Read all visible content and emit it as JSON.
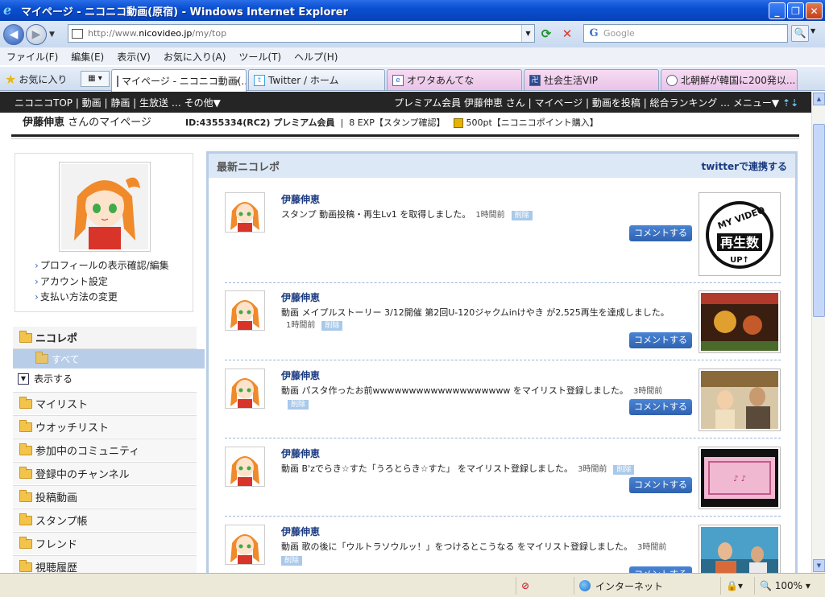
{
  "window": {
    "title": "マイページ - ニコニコ動画(原宿) - Windows Internet Explorer"
  },
  "address": {
    "url_prefix": "http://www.",
    "url_domain": "nicovideo.jp",
    "url_path": "/my/top"
  },
  "search": {
    "placeholder": "Google"
  },
  "menu": [
    "ファイル(F)",
    "編集(E)",
    "表示(V)",
    "お気に入り(A)",
    "ツール(T)",
    "ヘルプ(H)"
  ],
  "favorites_label": "お気に入り",
  "tabs": [
    {
      "label": "マイページ - ニコニコ動画(...",
      "icon": "page-icon"
    },
    {
      "label": "Twitter / ホーム",
      "icon": "twitter-icon"
    },
    {
      "label": "オワタあんてな",
      "icon": "ie-icon"
    },
    {
      "label": "社会生活VIP",
      "icon": "site-icon"
    },
    {
      "label": "北朝鮮が韓国に200発以...",
      "icon": "loading-icon"
    }
  ],
  "nicobar": {
    "left": "ニコニコTOP | 動画 | 静画 | 生放送 … その他▼",
    "right": "プレミアム会員 伊藤伸恵 さん | マイページ | 動画を投稿 | 総合ランキング … メニュー▼"
  },
  "user": {
    "name": "伊藤伸恵",
    "mypage_suffix": " さんのマイページ",
    "id_info": "ID:4355334(RC2) プレミアム会員",
    "exp": "8  EXP【スタンプ確認】",
    "points": "500pt【ニコニコポイント購入】"
  },
  "profile_links": [
    "プロフィールの表示確認/編集",
    "アカウント設定",
    "支払い方法の変更"
  ],
  "sidebar": {
    "nicorepo": "ニコレポ",
    "all": "すべて",
    "toggle": "表示する",
    "items": [
      "マイリスト",
      "ウオッチリスト",
      "参加中のコミュニティ",
      "登録中のチャンネル",
      "投稿動画",
      "スタンプ帳",
      "フレンド",
      "視聴履歴"
    ]
  },
  "main": {
    "title": "最新ニコレポ",
    "twitter_link": "twitterで連携する",
    "comment_label": "コメントする",
    "delete_label": "削除",
    "entries": [
      {
        "name": "伊藤伸恵",
        "text": "スタンプ 動画投稿・再生Lv1 を取得しました。",
        "time": "1時間前",
        "thumb": "MY VIDEO 再生数 UP↑"
      },
      {
        "name": "伊藤伸恵",
        "text": "動画  メイプルストーリー  3/12開催 第2回U-120ジャクムinけやき  が2,525再生を達成しました。",
        "time": "1時間前"
      },
      {
        "name": "伊藤伸恵",
        "text": "動画  パスタ作ったお前wwwwwwwwwwwwwwwwwww  をマイリスト登録しました。",
        "time": "3時間前"
      },
      {
        "name": "伊藤伸恵",
        "text": "動画  B'zでらき☆すた「うろとらき☆すた」 をマイリスト登録しました。",
        "time": "3時間前"
      },
      {
        "name": "伊藤伸恵",
        "text": "動画  歌の後に「ウルトラソウルッ！」をつけるとこうなる  をマイリスト登録しました。",
        "time": "3時間前"
      }
    ]
  },
  "status": {
    "zone": "インターネット",
    "zoom": "100%"
  }
}
